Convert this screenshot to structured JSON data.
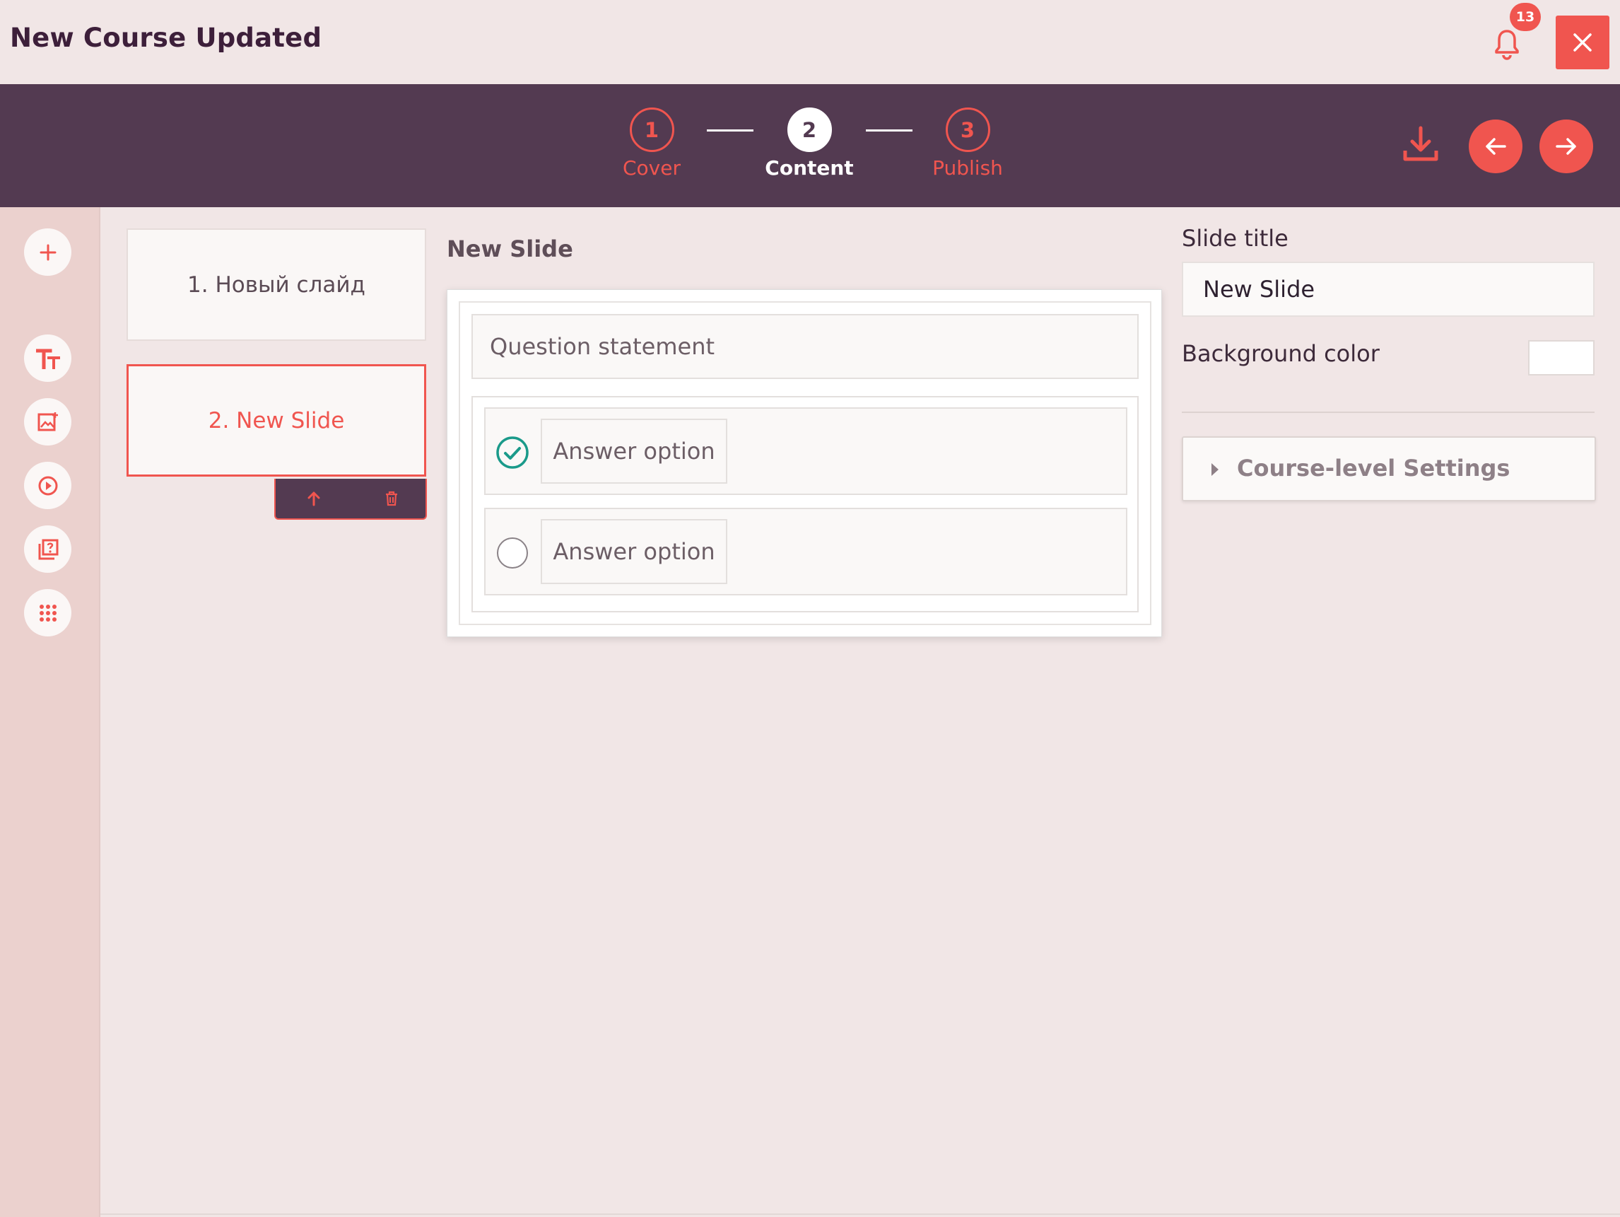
{
  "header": {
    "title": "New Course Updated",
    "notification_count": "13",
    "bell_icon": "bell-icon",
    "close_icon": "close-icon"
  },
  "wizard": {
    "steps": [
      {
        "number": "1",
        "label": "Cover",
        "active": false
      },
      {
        "number": "2",
        "label": "Content",
        "active": true
      },
      {
        "number": "3",
        "label": "Publish",
        "active": false
      }
    ],
    "actions": [
      "download-icon",
      "arrow-left-icon",
      "arrow-right-icon"
    ]
  },
  "rail": {
    "tools": [
      "plus-icon",
      "text-icon",
      "image-icon",
      "video-icon",
      "quiz-icon",
      "grid-icon"
    ]
  },
  "slides": [
    {
      "label": "1. Новый слайд",
      "active": false
    },
    {
      "label": "2. New Slide",
      "active": true
    }
  ],
  "slide_actions": [
    "arrow-up-icon",
    "trash-icon"
  ],
  "editor": {
    "slide_name": "New Slide",
    "question_placeholder": "Question statement",
    "answers": [
      {
        "text": "Answer option",
        "correct": true
      },
      {
        "text": "Answer option",
        "correct": false
      }
    ]
  },
  "properties": {
    "slide_title_label": "Slide title",
    "slide_title_value": "New Slide",
    "background_color_label": "Background color",
    "background_color_value": "#ffffff",
    "course_settings_label": "Course-level Settings"
  },
  "colors": {
    "accent": "#f0554f",
    "wizard_bg": "#533a51",
    "page_bg": "#f1e6e6",
    "rail_bg": "#ebd1ce",
    "correct_green": "#1a9a8a"
  }
}
